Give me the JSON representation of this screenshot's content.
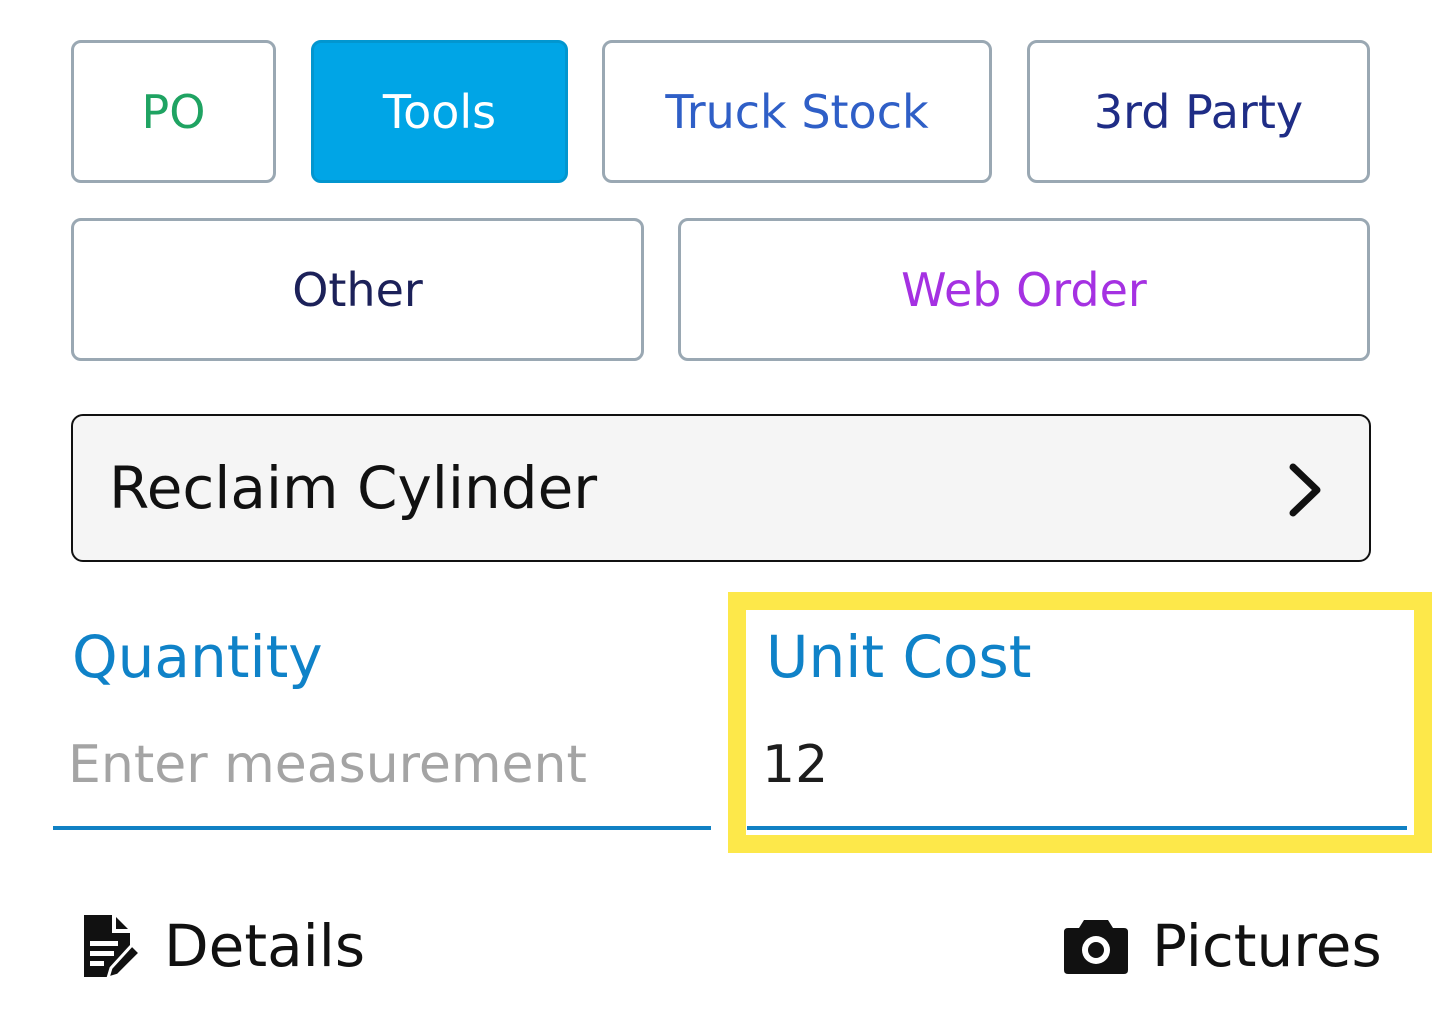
{
  "categories": {
    "po": "PO",
    "tools": "Tools",
    "truck_stock": "Truck Stock",
    "third_party": "3rd Party",
    "other": "Other",
    "web_order": "Web Order",
    "selected": "Tools"
  },
  "item_select": {
    "label": "Reclaim Cylinder",
    "icon": "chevron-right-icon"
  },
  "quantity": {
    "label": "Quantity",
    "placeholder": "Enter measurement",
    "value": ""
  },
  "unit_cost": {
    "label": "Unit Cost",
    "value": "12"
  },
  "links": {
    "details": "Details",
    "details_icon": "edit-document-icon",
    "pictures": "Pictures",
    "pictures_icon": "camera-icon"
  },
  "colors": {
    "selected_bg": "#00a5e6",
    "label_blue": "#0f82c8",
    "highlight": "#fde84a",
    "po": "#1fa362",
    "truck_stock": "#2f5fc7",
    "third_party": "#1f2d86",
    "other": "#1c2159",
    "web_order": "#a531e2"
  }
}
